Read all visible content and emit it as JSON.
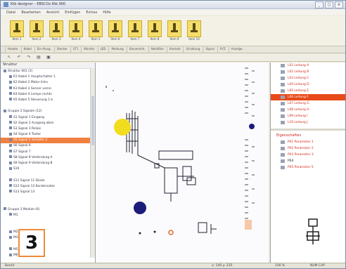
{
  "window": {
    "title": "Ktb designer – EBSCOs Ktb 900"
  },
  "menu": [
    "Datei",
    "Bearbeiten",
    "Ansicht",
    "Einfügen",
    "Extras",
    "Hilfe"
  ],
  "palette": {
    "items": [
      "Item 1",
      "Item 2",
      "Item 3",
      "Item 4",
      "Item 5",
      "Item 6",
      "Item 7",
      "Item 8",
      "Item 9",
      "Item 10"
    ]
  },
  "tabs": [
    "Header",
    "Kabel",
    "Ein-/Ausg.",
    "Stecker",
    "ST1",
    "Monitor",
    "LED",
    "Meldung",
    "Steuereinh.",
    "Netzfilter",
    "Kontakt",
    "Schaltung",
    "Signal",
    "XYZ",
    "Anzeige"
  ],
  "toolbar": {
    "icons": [
      "cursor-icon",
      "undo-icon",
      "redo-icon",
      "print-icon",
      "save-icon"
    ]
  },
  "left_tree": {
    "header": "Struktur",
    "rows": [
      {
        "text": "Struktur 001 (2)",
        "sel": false
      },
      {
        "text": "K1  Kabel 1  Hauptschalter 1",
        "sel": false
      },
      {
        "text": "K2  Kabel 2  Motor links",
        "sel": false
      },
      {
        "text": "K3  Kabel 3  Sensor vorne",
        "sel": false
      },
      {
        "text": "K4  Kabel 4  Lampe rechts",
        "sel": false
      },
      {
        "text": "K5  Kabel 5  Steuerung 1 b",
        "sel": false
      },
      {
        "text": "",
        "sel": false
      },
      {
        "text": "Gruppe 2 Signale (12)",
        "sel": false
      },
      {
        "text": "S1  Signal 1  Eingang",
        "sel": false
      },
      {
        "text": "S2  Signal 2  Ausgang oben",
        "sel": false
      },
      {
        "text": "S3  Signal 3  Relais",
        "sel": false
      },
      {
        "text": "S4  Signal 4  Taster",
        "sel": false
      },
      {
        "text": "S5  Signal 5  Schalter 2",
        "sel": true
      },
      {
        "text": "S6  Signal 6",
        "sel": false
      },
      {
        "text": "S7  Signal 7",
        "sel": false
      },
      {
        "text": "S8  Signal 8  Verbindung A",
        "sel": false
      },
      {
        "text": "S9  Signal 9  Verbindung B",
        "sel": false
      },
      {
        "text": "S10",
        "sel": false
      },
      {
        "text": "",
        "sel": false
      },
      {
        "text": "S11  Signal 11  Diode",
        "sel": false
      },
      {
        "text": "S12  Signal 12  Kondensator",
        "sel": false
      },
      {
        "text": "S13  Signal 13",
        "sel": false
      },
      {
        "text": "",
        "sel": false
      },
      {
        "text": "",
        "sel": false
      },
      {
        "text": "Gruppe 3 Module (6)",
        "sel": false
      },
      {
        "text": "M1",
        "sel": false
      },
      {
        "text": "",
        "sel": false
      },
      {
        "text": "",
        "sel": false
      },
      {
        "text": "M2  Modul 2",
        "sel": false
      },
      {
        "text": "M3  Modul 3",
        "sel": false
      },
      {
        "text": "",
        "sel": false
      },
      {
        "text": "M5  5.0  Modul Ende",
        "sel": false
      },
      {
        "text": "M6",
        "sel": false
      }
    ]
  },
  "marker": {
    "label": "3"
  },
  "right_top": [
    {
      "text": "L01 Leitung A",
      "kind": "red"
    },
    {
      "text": "L02 Leitung B",
      "kind": "red"
    },
    {
      "text": "L03 Leitung C",
      "kind": "red"
    },
    {
      "text": "L04 Leitung D",
      "kind": "red"
    },
    {
      "text": "L05 Leitung E",
      "kind": "red"
    },
    {
      "text": "L06 Leitung F",
      "kind": "sel"
    },
    {
      "text": "L07 Leitung G",
      "kind": "red"
    },
    {
      "text": "L08 Leitung H",
      "kind": "red"
    },
    {
      "text": "L09 Leitung I",
      "kind": "red"
    },
    {
      "text": "L10 Leitung J",
      "kind": "red"
    }
  ],
  "right_bottom": {
    "header": "Eigenschaften",
    "rows": [
      {
        "text": "P01 Parameter 1",
        "kind": "red"
      },
      {
        "text": "P02 Parameter 2",
        "kind": "red"
      },
      {
        "text": "P03 Parameter 3",
        "kind": "red"
      },
      {
        "text": "P04",
        "kind": "plain"
      },
      {
        "text": "P05 Parameter 5",
        "kind": "red"
      }
    ]
  },
  "statusbar": {
    "left": "Bereit",
    "mid": "x: 140  y: 235",
    "right1": "100 %",
    "right2": "NUM  CAP"
  },
  "colors": {
    "accent": "#e84a1a",
    "yellow": "#f2dc1e",
    "navy": "#1c1c7a"
  }
}
